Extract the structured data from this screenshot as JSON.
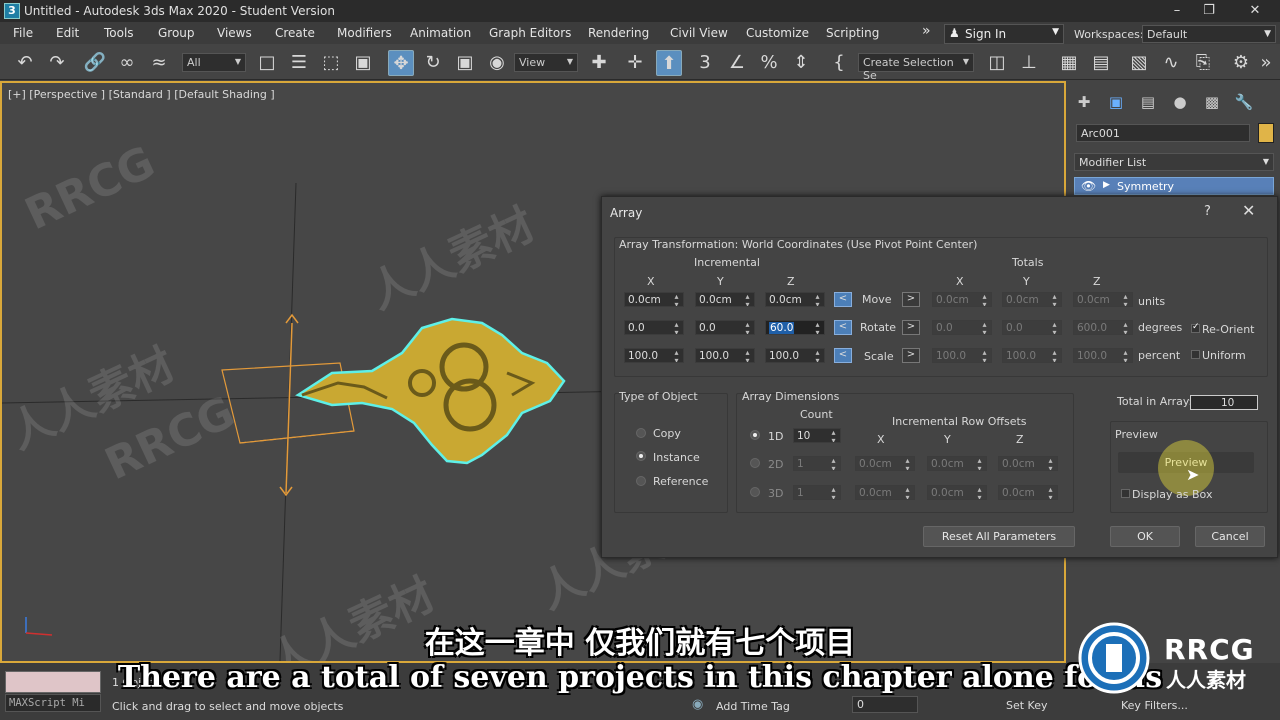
{
  "window": {
    "title": "Untitled - Autodesk 3ds Max 2020 - Student Version",
    "app_icon": "3"
  },
  "menu": {
    "items": [
      "File",
      "Edit",
      "Tools",
      "Group",
      "Views",
      "Create",
      "Modifiers",
      "Animation",
      "Graph Editors",
      "Rendering",
      "Civil View",
      "Customize",
      "Scripting"
    ],
    "overflow": "»",
    "sign_in": "Sign In",
    "workspaces_label": "Workspaces:",
    "workspace_value": "Default"
  },
  "toolbar": {
    "selection_filter": "All",
    "ref_coord": "View",
    "named_selection": "Create Selection Se"
  },
  "viewport": {
    "label": "[+] [Perspective ] [Standard ] [Default Shading ]"
  },
  "command_panel": {
    "object_name": "Arc001",
    "object_color": "#e0b448",
    "modifier_list": "Modifier List",
    "stack_item": "Symmetry"
  },
  "dialog": {
    "title": "Array",
    "help": "?",
    "close": "✕",
    "transform_title": "Array Transformation: World Coordinates (Use Pivot Point Center)",
    "incremental_label": "Incremental",
    "totals_label": "Totals",
    "axes": [
      "X",
      "Y",
      "Z"
    ],
    "rows": [
      {
        "name": "Move",
        "inc": [
          "0.0cm",
          "0.0cm",
          "0.0cm"
        ],
        "tot": [
          "0.0cm",
          "0.0cm",
          "0.0cm"
        ],
        "unit": "units"
      },
      {
        "name": "Rotate",
        "inc": [
          "0.0",
          "0.0",
          "60.0"
        ],
        "tot": [
          "0.0",
          "0.0",
          "600.0"
        ],
        "unit": "degrees"
      },
      {
        "name": "Scale",
        "inc": [
          "100.0",
          "100.0",
          "100.0"
        ],
        "tot": [
          "100.0",
          "100.0",
          "100.0"
        ],
        "unit": "percent"
      }
    ],
    "re_orient": "Re-Orient",
    "uniform": "Uniform",
    "type_title": "Type of Object",
    "type_options": [
      "Copy",
      "Instance",
      "Reference"
    ],
    "type_selected": "Instance",
    "dims_title": "Array Dimensions",
    "count_label": "Count",
    "row_offsets_label": "Incremental Row Offsets",
    "dims": [
      {
        "name": "1D",
        "count": "10",
        "x": "",
        "y": "",
        "z": ""
      },
      {
        "name": "2D",
        "count": "1",
        "x": "0.0cm",
        "y": "0.0cm",
        "z": "0.0cm"
      },
      {
        "name": "3D",
        "count": "1",
        "x": "0.0cm",
        "y": "0.0cm",
        "z": "0.0cm"
      }
    ],
    "total_label": "Total in Array:",
    "total_value": "10",
    "preview_title": "Preview",
    "preview_button": "Preview",
    "display_as_box": "Display as Box",
    "reset": "Reset All Parameters",
    "ok": "OK",
    "cancel": "Cancel"
  },
  "status": {
    "maxscript": "MAXScript Mi",
    "selection_count": "1 Object Se",
    "prompt": "Click and drag to select and move objects",
    "add_time_tag": "Add Time Tag",
    "frame": "0",
    "set_key": "Set Key",
    "key_filters": "Key Filters..."
  },
  "subtitles": {
    "chinese": "在这一章中 仅我们就有七个项目",
    "english": "There are a total of seven projects in this chapter alone for us"
  },
  "watermark": {
    "logo": "RRCG",
    "logo_sub": "人人素材"
  }
}
